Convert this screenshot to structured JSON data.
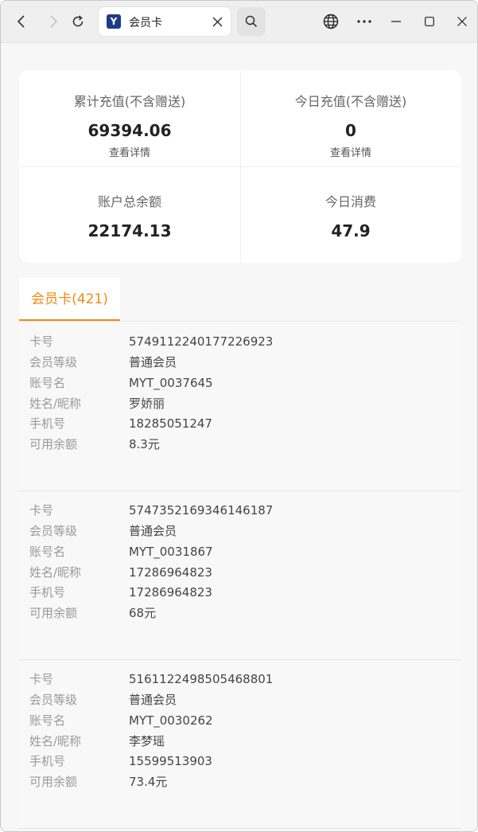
{
  "browser": {
    "tab_title": "会员卡",
    "favicon_letter": "Y"
  },
  "stats": {
    "total_recharge": {
      "label": "累计充值(不含赠送)",
      "value": "69394.06",
      "link": "查看详情"
    },
    "today_recharge": {
      "label": "今日充值(不含赠送)",
      "value": "0",
      "link": "查看详情"
    },
    "account_balance": {
      "label": "账户总余额",
      "value": "22174.13"
    },
    "today_consume": {
      "label": "今日消费",
      "value": "47.9"
    }
  },
  "tab": {
    "label": "会员卡(421)"
  },
  "field_labels": {
    "card_no": "卡号",
    "level": "会员等级",
    "account": "账号名",
    "name": "姓名/昵称",
    "phone": "手机号",
    "balance": "可用余额"
  },
  "cards": [
    {
      "card_no": "5749112240177226923",
      "level": "普通会员",
      "account": "MYT_0037645",
      "name": "罗娇丽",
      "phone": "18285051247",
      "balance": "8.3元"
    },
    {
      "card_no": "5747352169346146187",
      "level": "普通会员",
      "account": "MYT_0031867",
      "name": "17286964823",
      "phone": "17286964823",
      "balance": "68元"
    },
    {
      "card_no": "5161122498505468801",
      "level": "普通会员",
      "account": "MYT_0030262",
      "name": "李梦瑶",
      "phone": "15599513903",
      "balance": "73.4元"
    }
  ],
  "colors": {
    "accent": "#f08a10",
    "favicon": "#1d3c86"
  }
}
